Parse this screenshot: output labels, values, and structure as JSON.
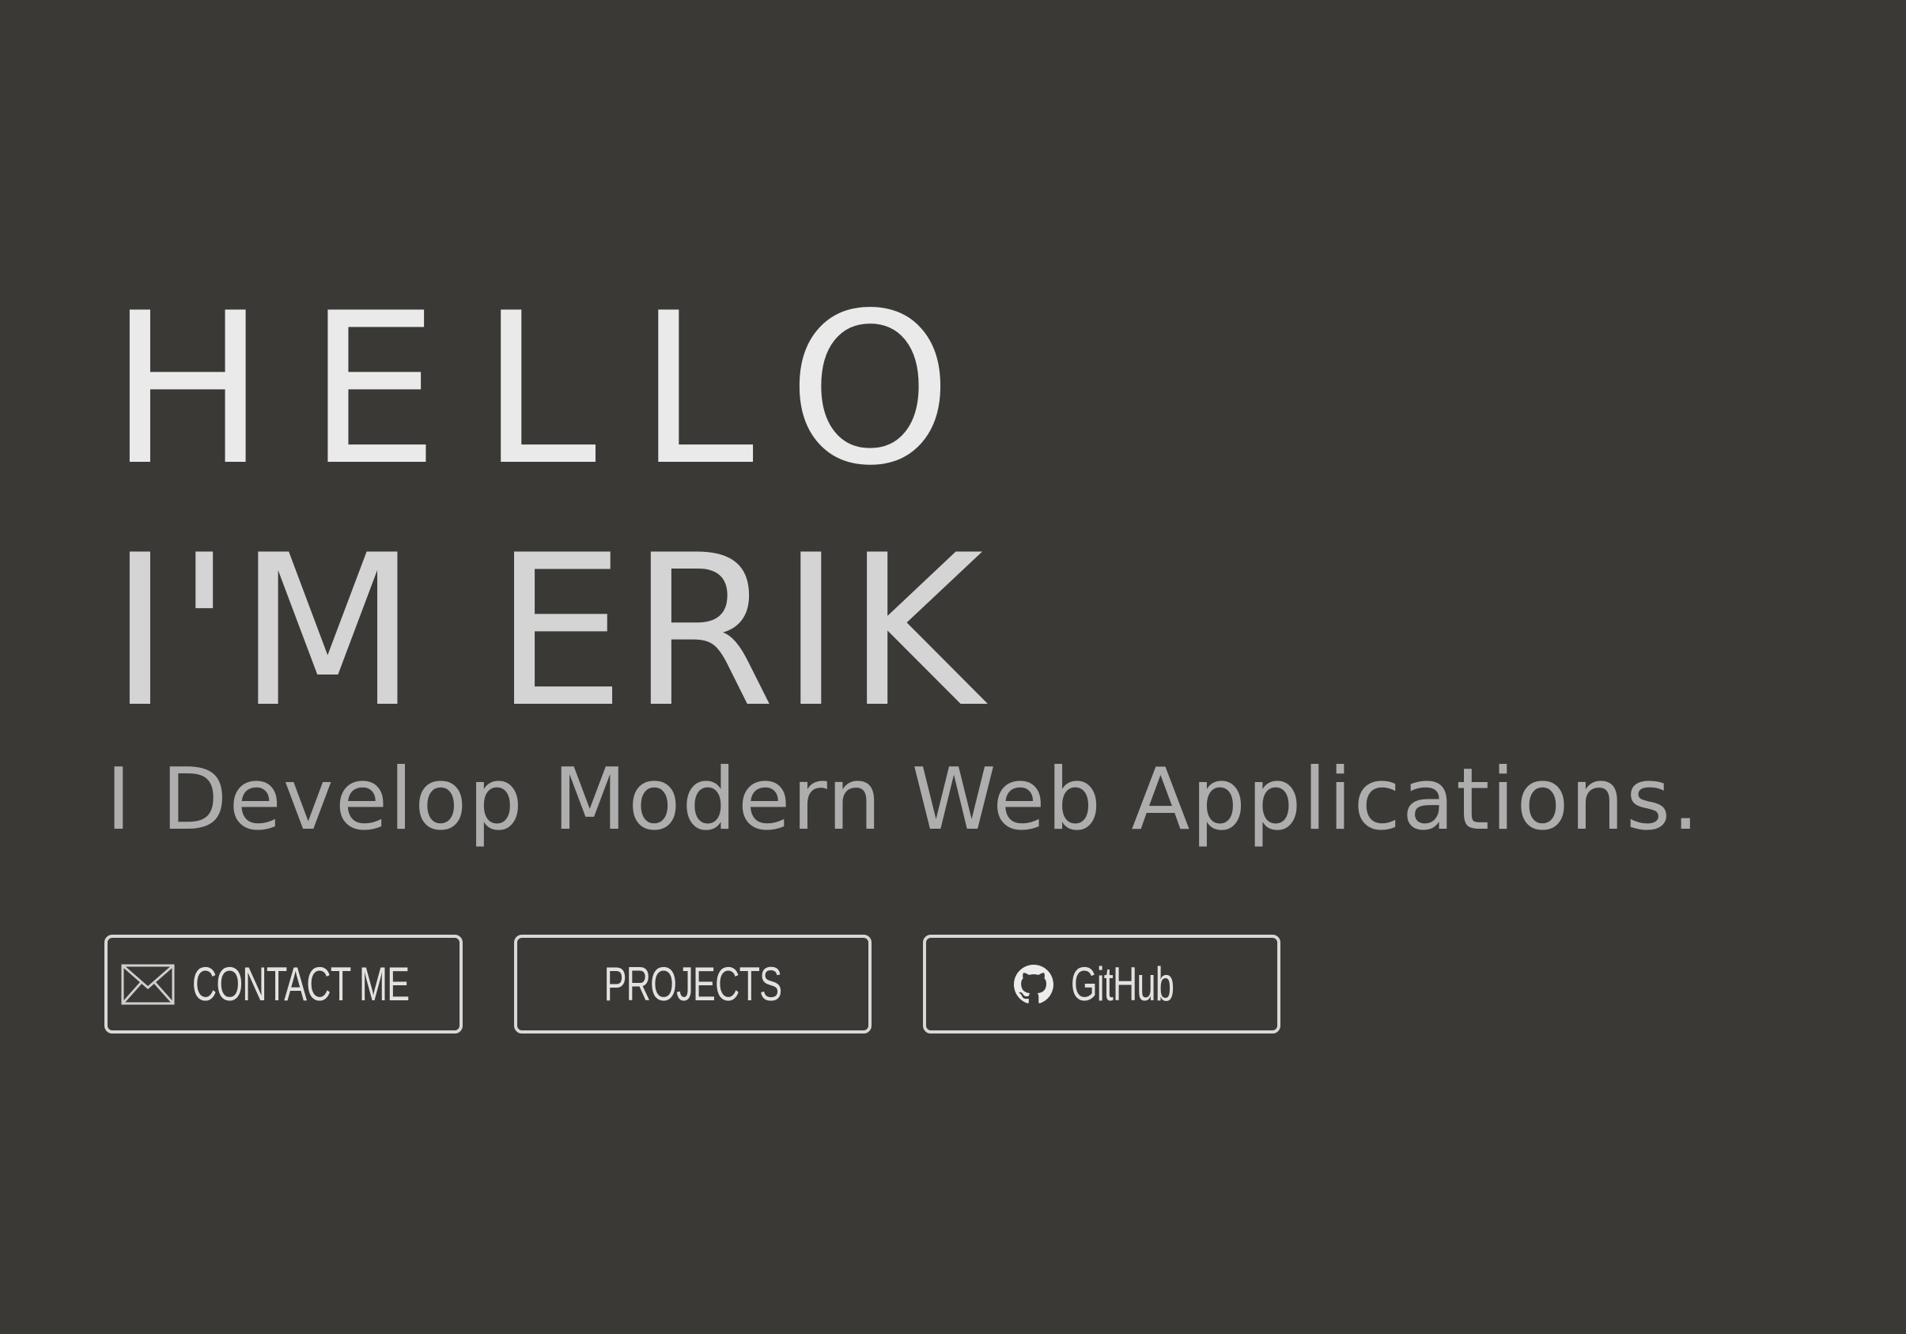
{
  "hero": {
    "greeting": "HELLO",
    "name": "I'M ERIK",
    "tagline": "I Develop Modern Web Applications."
  },
  "buttons": [
    {
      "label": "CONTACT ME",
      "icon": "envelope-icon"
    },
    {
      "label": "PROJECTS"
    },
    {
      "label": "GitHub",
      "icon": "github-icon"
    }
  ],
  "colors": {
    "background": "#3b3936",
    "greeting": "#eaeaea",
    "name": "#d4d4d4",
    "tagline": "#aeaeae",
    "button_border": "#d8d8d8",
    "button_text": "#e2e2e2"
  }
}
